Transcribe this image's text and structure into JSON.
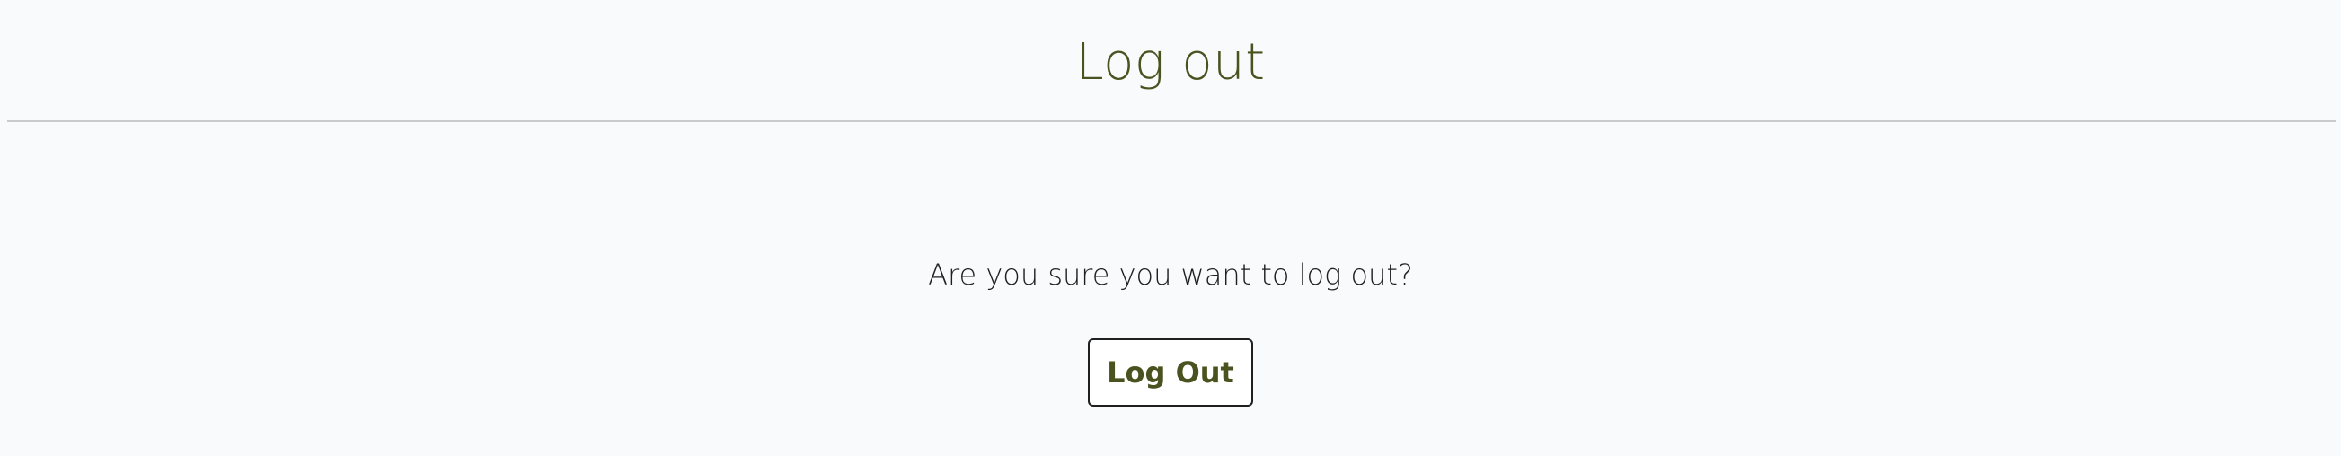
{
  "header": {
    "title": "Log out"
  },
  "main": {
    "prompt": "Are you sure you want to log out?",
    "logout_button_label": "Log Out"
  },
  "colors": {
    "background": "#f9fafc",
    "title_text": "#4a5220",
    "button_text": "#4a5220",
    "body_text": "#1f1f1f",
    "divider": "#c9cbcf"
  }
}
